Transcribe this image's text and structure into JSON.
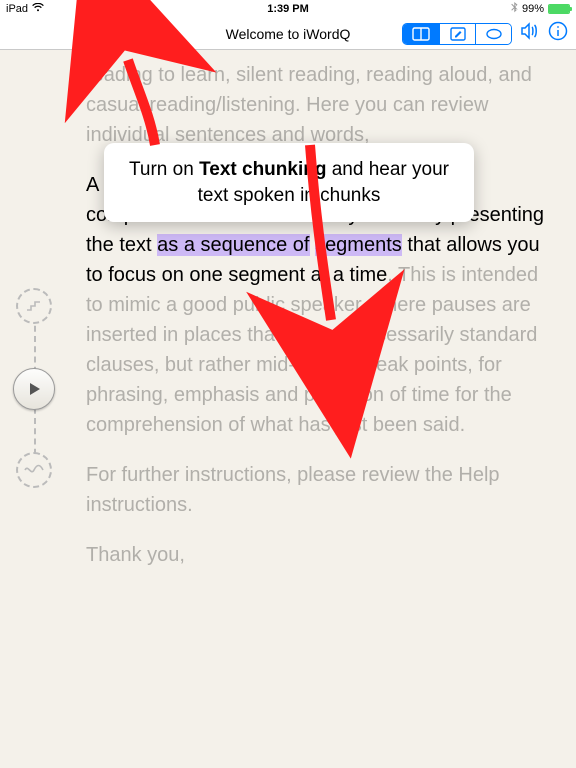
{
  "statusbar": {
    "device": "iPad",
    "time": "1:39 PM",
    "battery_pct": "99%"
  },
  "toolbar": {
    "title": "Welcome to iWordQ"
  },
  "callout": {
    "pre": "Turn on ",
    "bold": "Text chunking",
    "post": " and hear your text spoken in chunks"
  },
  "body": {
    "intro_faded": "reading to learn, silent reading, reading aloud, and casual reading/listening. Here you can review individual sentences and words,",
    "p2_pre": "A novel Reading mode option enhances comprehension and readability of text by presenting the text ",
    "p2_hl1": "as a sequence of",
    "p2_sp": " ",
    "p2_hl2": "segments",
    "p2_mid": " that allows you to focus on one segment at a time",
    "p2_faded": ". This is intended to mimic a good public speaker, where pauses are inserted in places that are not necessarily standard clauses, but rather mid-clause break points, for phrasing, emphasis and provision of time for the comprehension of what has just been said.",
    "p3": "For further instructions, please review the Help instructions.",
    "p4": "Thank you,"
  }
}
